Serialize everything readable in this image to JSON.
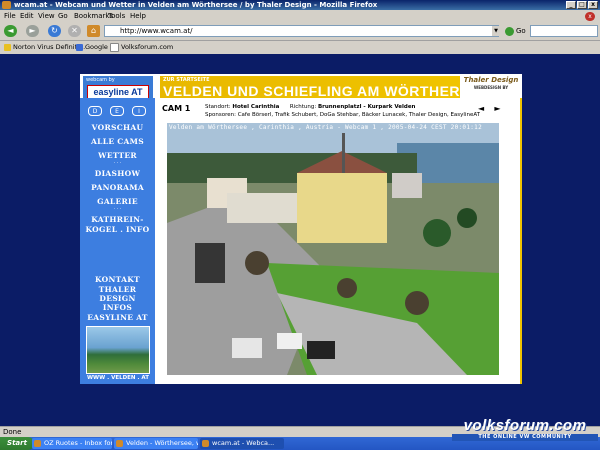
{
  "window": {
    "title": "wcam.at - Webcam und Wetter in Velden am Wörthersee / by Thaler Design - Mozilla Firefox",
    "close_tab_label": "x"
  },
  "menu": {
    "file": "File",
    "edit": "Edit",
    "view": "View",
    "go": "Go",
    "bookmarks": "Bookmarks",
    "tools": "Tools",
    "help": "Help"
  },
  "navbar": {
    "url": "http://www.wcam.at/",
    "go_label": "Go"
  },
  "bookmarks_bar": {
    "items": [
      "Norton Virus Definiti...",
      "Google",
      "Volksforum.com"
    ]
  },
  "banner": {
    "brand_small": "webcam by",
    "brand": "easyline AT",
    "zur_startseite": "ZUR STARTSEITE",
    "heading": "VELDEN UND SCHIEFLING AM WÖRTHERSEE",
    "thaler": "Thaler Design",
    "thaler_sub": "WEBDESIGN BY"
  },
  "sidebar": {
    "dot_buttons": [
      "D",
      "E",
      "I"
    ],
    "items": {
      "vorschau": "VORSCHAU",
      "alle_cams": "ALLE CAMS",
      "wetter": "WETTER",
      "diashow": "DIASHOW",
      "panorama": "PANORAMA",
      "galerie": "GALERIE",
      "kathreinkogel_1": "KATHREIN-",
      "kathreinkogel_2": "KOGEL . INFO",
      "kontakt": "KONTAKT",
      "thaler_design": "THALER DESIGN",
      "infos": "INFOS",
      "easyline": "EASYLINE AT"
    },
    "separator": "· · ·",
    "caption": "WWW . VELDEN . AT"
  },
  "camera": {
    "title": "CAM 1",
    "standort_label": "Standort:",
    "standort": "Hotel Carinthia",
    "richtung_label": "Richtung:",
    "richtung": "Brunnenplatzl - Kurpark Velden",
    "sponsoren_label": "Sponsoren:",
    "sponsoren": "Cafe Börserl, Trafik Schubert, DoGa Stehbar, Bäcker Lunacek, Thaler Design, EasylineAT",
    "prev": "◄",
    "next": "►",
    "overlay": "Velden am Wörthersee , Carinthia , Austria - Webcam 1 , 2005-04-24 CEST 20:01:12"
  },
  "status": {
    "text": "Done"
  },
  "taskbar": {
    "start": "Start",
    "tasks": [
      "OZ Ruotes - Inbox for in...",
      "Velden - Wörthersee, wa...",
      "wcam.at - Webca..."
    ]
  },
  "watermark": {
    "main": "volksforum.com",
    "sub": "THE ONLINE VW COMMUNITY"
  }
}
